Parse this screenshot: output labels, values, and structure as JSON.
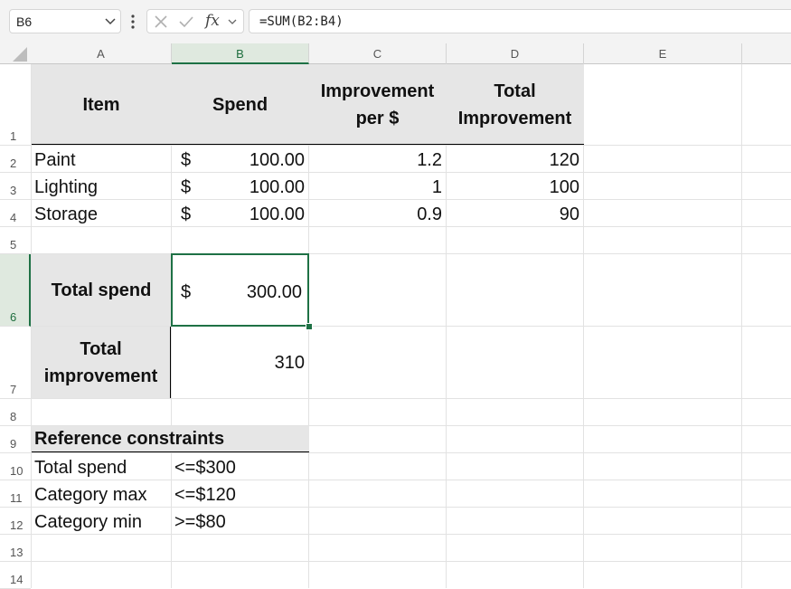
{
  "formula_bar": {
    "name_box": "B6",
    "formula": "=SUM(B2:B4)",
    "fx_label": "fx"
  },
  "icons": [
    "chevron-down-icon",
    "more-vertical-icon",
    "cancel-x-icon",
    "confirm-check-icon",
    "function-icon"
  ],
  "columns": [
    "A",
    "B",
    "C",
    "D",
    "E"
  ],
  "rows": [
    "1",
    "2",
    "3",
    "4",
    "5",
    "6",
    "7",
    "8",
    "9",
    "10",
    "11",
    "12",
    "13",
    "14"
  ],
  "selected": {
    "column": "B",
    "row": "6",
    "cell": "B6"
  },
  "colors": {
    "accent": "#1e7145",
    "header_fill": "#e6e6e6",
    "selection_header": "#dfe9df"
  },
  "sheet": {
    "header": {
      "item": "Item",
      "spend": "Spend",
      "improvement_per_dollar_line1": "Improvement",
      "improvement_per_dollar_line2": "per $",
      "total_improvement_line1": "Total",
      "total_improvement_line2": "Improvement"
    },
    "items": [
      {
        "name": "Paint",
        "currency": "$",
        "spend": "100.00",
        "improvement_per_dollar": "1.2",
        "total_improvement": "120"
      },
      {
        "name": "Lighting",
        "currency": "$",
        "spend": "100.00",
        "improvement_per_dollar": "1",
        "total_improvement": "100"
      },
      {
        "name": "Storage",
        "currency": "$",
        "spend": "100.00",
        "improvement_per_dollar": "0.9",
        "total_improvement": "90"
      }
    ],
    "total_spend": {
      "label": "Total spend",
      "currency": "$",
      "value": "300.00"
    },
    "total_improvement": {
      "label_line1": "Total",
      "label_line2": "improvement",
      "value": "310"
    },
    "constraints": {
      "title": "Reference constraints",
      "rows": [
        {
          "label": "Total spend",
          "value": "<=$300"
        },
        {
          "label": "Category max",
          "value": "<=$120"
        },
        {
          "label": "Category min",
          "value": ">=$80"
        }
      ]
    }
  }
}
